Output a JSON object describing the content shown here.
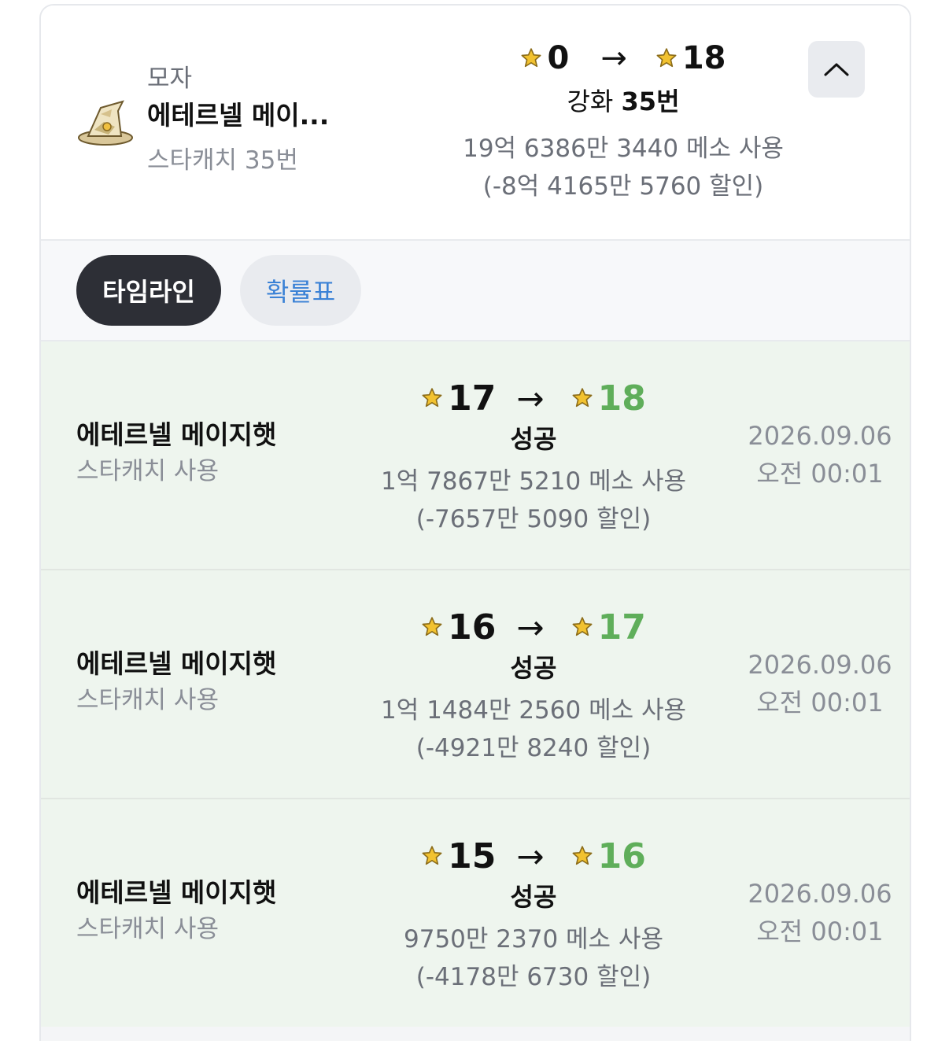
{
  "summary": {
    "category": "모자",
    "item_name": "에테르넬 메이...",
    "starcatch": "스타캐치 35번",
    "star_from": "0",
    "star_to": "18",
    "enhance_prefix": "강화",
    "enhance_count": "35번",
    "meso_used": "19억 6386만 3440 메소 사용",
    "meso_discount": "(-8억 4165만 5760 할인)",
    "collapse_icon": "chevron-up-icon"
  },
  "tabs": [
    {
      "label": "타임라인",
      "active": true
    },
    {
      "label": "확률표",
      "active": false
    }
  ],
  "timeline": [
    {
      "item_name": "에테르넬 메이지햇",
      "starcatch": "스타캐치 사용",
      "star_from": "17",
      "star_to": "18",
      "result": "성공",
      "meso_used": "1억 7867만 5210 메소 사용",
      "meso_discount": "(-7657만 5090 할인)",
      "date": "2026.09.06",
      "time": "오전 00:01"
    },
    {
      "item_name": "에테르넬 메이지햇",
      "starcatch": "스타캐치 사용",
      "star_from": "16",
      "star_to": "17",
      "result": "성공",
      "meso_used": "1억 1484만 2560 메소 사용",
      "meso_discount": "(-4921만 8240 할인)",
      "date": "2026.09.06",
      "time": "오전 00:01"
    },
    {
      "item_name": "에테르넬 메이지햇",
      "starcatch": "스타캐치 사용",
      "star_from": "15",
      "star_to": "16",
      "result": "성공",
      "meso_used": "9750만 2370 메소 사용",
      "meso_discount": "(-4178만 6730 할인)",
      "date": "2026.09.06",
      "time": "오전 00:01"
    }
  ],
  "colors": {
    "success_green": "#5fae5a",
    "row_bg": "#eef5ee",
    "tab_active_bg": "#2d2f36",
    "tab_link_blue": "#3b82d6",
    "star_gold": "#f2c230"
  },
  "icons": {
    "star": "star-icon",
    "arrow": "arrow-right-icon",
    "item": "wizard-hat-icon"
  }
}
